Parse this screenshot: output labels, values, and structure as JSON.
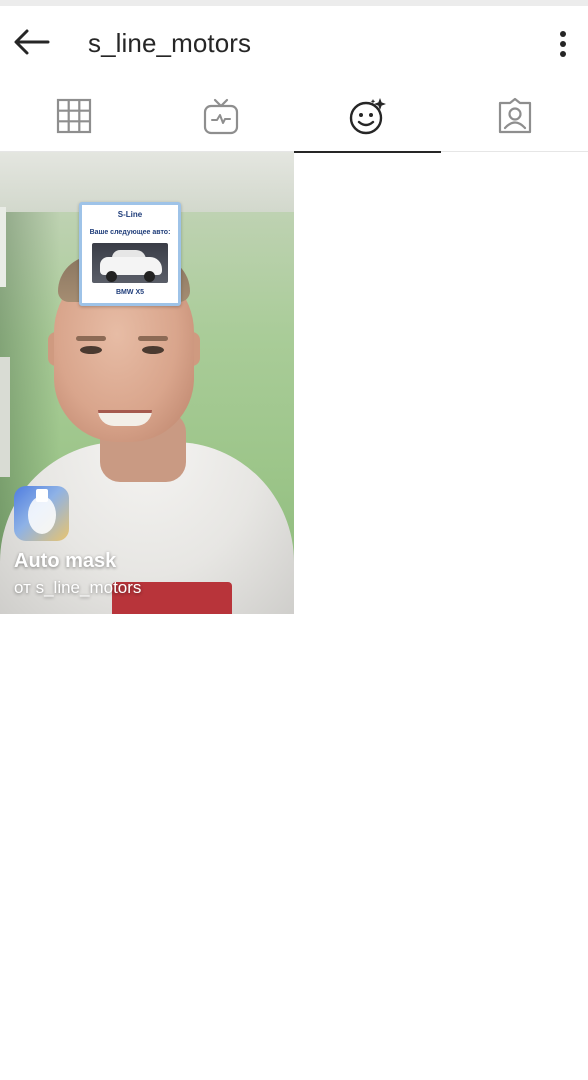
{
  "header": {
    "title": "s_line_motors",
    "back_icon": "arrow-left-icon",
    "more_icon": "more-vertical-icon"
  },
  "tabs": [
    {
      "name": "grid",
      "icon": "grid-icon",
      "active": false
    },
    {
      "name": "igtv",
      "icon": "igtv-icon",
      "active": false
    },
    {
      "name": "effects",
      "icon": "effects-face-icon",
      "active": true
    },
    {
      "name": "tagged",
      "icon": "tagged-person-icon",
      "active": false
    }
  ],
  "effects": [
    {
      "name": "Auto mask",
      "author": "от s_line_motors",
      "preview": {
        "logo": "S-Line",
        "caption": "Ваше следующее авто:",
        "model": "BMW X5"
      }
    }
  ],
  "colors": {
    "text": "#262626",
    "divider": "#e6e6e6",
    "active_indicator": "#262626",
    "mask_blue": "#1f3d7a"
  }
}
